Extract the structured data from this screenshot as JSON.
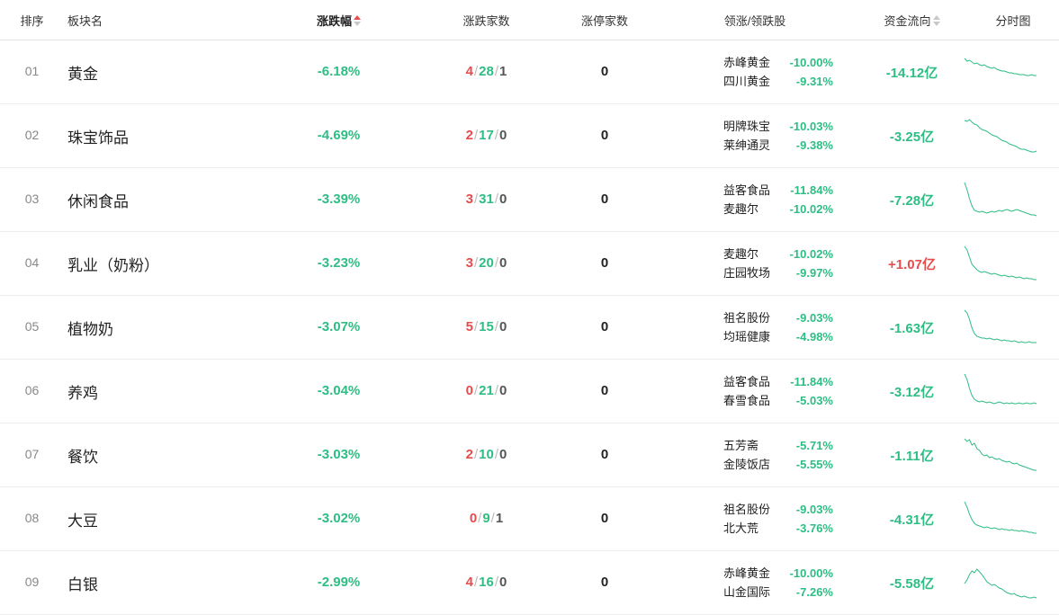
{
  "headers": {
    "rank": "排序",
    "name": "板块名",
    "change": "涨跌幅",
    "count": "涨跌家数",
    "limit_up": "涨停家数",
    "leaders": "领涨/领跌股",
    "flow": "资金流向",
    "chart": "分时图"
  },
  "colors": {
    "up": "#e74c4c",
    "down": "#2ebd85",
    "accent_sort": "#e74c4c"
  },
  "rows": [
    {
      "rank": "01",
      "name": "黄金",
      "change": "-6.18%",
      "up": "4",
      "down": "28",
      "flat": "1",
      "limit_up": "0",
      "lead1_name": "赤峰黄金",
      "lead1_pct": "-10.00%",
      "lead2_name": "四川黄金",
      "lead2_pct": "-9.31%",
      "flow": "-14.12亿",
      "flow_sign": "neg",
      "spark": [
        6,
        9,
        8,
        10,
        12,
        11,
        13,
        14,
        13,
        15,
        16,
        17,
        16,
        18,
        19,
        20,
        20,
        21,
        22,
        22,
        23,
        23,
        24,
        24,
        24,
        25,
        25,
        24,
        25,
        25
      ]
    },
    {
      "rank": "02",
      "name": "珠宝饰品",
      "change": "-4.69%",
      "up": "2",
      "down": "17",
      "flat": "0",
      "limit_up": "0",
      "lead1_name": "明牌珠宝",
      "lead1_pct": "-10.03%",
      "lead2_name": "莱绅通灵",
      "lead2_pct": "-9.38%",
      "flow": "-3.25亿",
      "flow_sign": "neg",
      "spark": [
        4,
        5,
        3,
        6,
        8,
        9,
        12,
        14,
        15,
        16,
        18,
        20,
        21,
        22,
        24,
        26,
        27,
        28,
        30,
        31,
        32,
        33,
        35,
        36,
        36,
        37,
        38,
        39,
        39,
        38
      ]
    },
    {
      "rank": "03",
      "name": "休闲食品",
      "change": "-3.39%",
      "up": "3",
      "down": "31",
      "flat": "0",
      "limit_up": "0",
      "lead1_name": "益客食品",
      "lead1_pct": "-11.84%",
      "lead2_name": "麦趣尔",
      "lead2_pct": "-10.02%",
      "flow": "-7.28亿",
      "flow_sign": "neg",
      "spark": [
        2,
        10,
        20,
        28,
        33,
        34,
        35,
        34,
        35,
        36,
        35,
        34,
        35,
        34,
        33,
        34,
        33,
        32,
        33,
        34,
        33,
        32,
        33,
        34,
        35,
        36,
        37,
        38,
        38,
        39
      ]
    },
    {
      "rank": "04",
      "name": "乳业（奶粉）",
      "change": "-3.23%",
      "up": "3",
      "down": "20",
      "flat": "0",
      "limit_up": "0",
      "lead1_name": "麦趣尔",
      "lead1_pct": "-10.02%",
      "lead2_name": "庄园牧场",
      "lead2_pct": "-9.97%",
      "flow": "+1.07亿",
      "flow_sign": "pos",
      "spark": [
        2,
        6,
        14,
        22,
        25,
        28,
        30,
        31,
        30,
        31,
        32,
        33,
        32,
        33,
        34,
        35,
        34,
        35,
        36,
        35,
        36,
        37,
        36,
        37,
        38,
        37,
        38,
        38,
        39,
        39
      ]
    },
    {
      "rank": "05",
      "name": "植物奶",
      "change": "-3.07%",
      "up": "5",
      "down": "15",
      "flat": "0",
      "limit_up": "0",
      "lead1_name": "祖名股份",
      "lead1_pct": "-9.03%",
      "lead2_name": "均瑶健康",
      "lead2_pct": "-4.98%",
      "flow": "-1.63亿",
      "flow_sign": "neg",
      "spark": [
        2,
        5,
        12,
        22,
        28,
        31,
        32,
        33,
        33,
        34,
        33,
        34,
        35,
        34,
        35,
        36,
        35,
        36,
        36,
        37,
        36,
        37,
        38,
        37,
        38,
        38,
        37,
        38,
        38,
        38
      ]
    },
    {
      "rank": "06",
      "name": "养鸡",
      "change": "-3.04%",
      "up": "0",
      "down": "21",
      "flat": "0",
      "limit_up": "0",
      "lead1_name": "益客食品",
      "lead1_pct": "-11.84%",
      "lead2_name": "春雪食品",
      "lead2_pct": "-5.03%",
      "flow": "-3.12亿",
      "flow_sign": "neg",
      "spark": [
        2,
        8,
        18,
        26,
        30,
        32,
        33,
        32,
        33,
        34,
        33,
        34,
        35,
        34,
        33,
        34,
        35,
        34,
        35,
        34,
        35,
        35,
        34,
        35,
        35,
        34,
        35,
        35,
        34,
        35
      ]
    },
    {
      "rank": "07",
      "name": "餐饮",
      "change": "-3.03%",
      "up": "2",
      "down": "10",
      "flat": "0",
      "limit_up": "0",
      "lead1_name": "五芳斋",
      "lead1_pct": "-5.71%",
      "lead2_name": "金陵饭店",
      "lead2_pct": "-5.55%",
      "flow": "-1.11亿",
      "flow_sign": "neg",
      "spark": [
        3,
        6,
        4,
        10,
        8,
        14,
        16,
        20,
        22,
        21,
        24,
        23,
        25,
        26,
        25,
        27,
        28,
        29,
        28,
        30,
        31,
        30,
        32,
        33,
        34,
        35,
        36,
        37,
        38,
        38
      ]
    },
    {
      "rank": "08",
      "name": "大豆",
      "change": "-3.02%",
      "up": "0",
      "down": "9",
      "flat": "1",
      "limit_up": "0",
      "lead1_name": "祖名股份",
      "lead1_pct": "-9.03%",
      "lead2_name": "北大荒",
      "lead2_pct": "-3.76%",
      "flow": "-4.31亿",
      "flow_sign": "neg",
      "spark": [
        2,
        8,
        16,
        22,
        26,
        28,
        29,
        30,
        31,
        30,
        31,
        32,
        31,
        32,
        33,
        32,
        33,
        33,
        34,
        33,
        34,
        34,
        35,
        34,
        35,
        35,
        36,
        36,
        37,
        37
      ]
    },
    {
      "rank": "09",
      "name": "白银",
      "change": "-2.99%",
      "up": "4",
      "down": "16",
      "flat": "0",
      "limit_up": "0",
      "lead1_name": "赤峰黄金",
      "lead1_pct": "-10.00%",
      "lead2_name": "山金国际",
      "lead2_pct": "-7.26%",
      "flow": "-5.58亿",
      "flow_sign": "neg",
      "spark": [
        22,
        18,
        12,
        8,
        10,
        6,
        9,
        12,
        16,
        20,
        22,
        24,
        23,
        25,
        27,
        28,
        30,
        32,
        33,
        34,
        33,
        35,
        36,
        37,
        36,
        37,
        38,
        38,
        37,
        38
      ]
    }
  ]
}
